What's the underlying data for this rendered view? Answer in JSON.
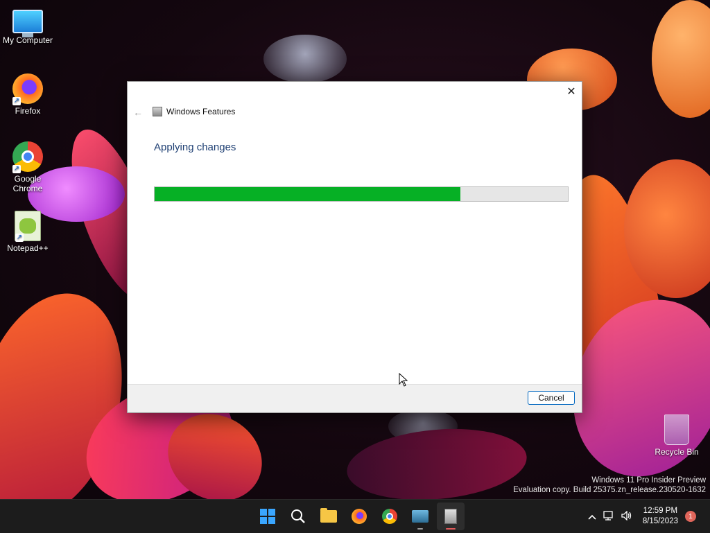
{
  "desktop": {
    "icons": [
      {
        "label": "My Computer",
        "icon": "computer-icon"
      },
      {
        "label": "Firefox",
        "icon": "firefox-icon"
      },
      {
        "label": "Google Chrome",
        "icon": "chrome-icon"
      },
      {
        "label": "Notepad++",
        "icon": "notepadpp-icon"
      },
      {
        "label": "Recycle Bin",
        "icon": "recycle-bin-icon"
      }
    ]
  },
  "dialog": {
    "window_title": "Windows Features",
    "heading": "Applying changes",
    "progress_percent": 74,
    "cancel_label": "Cancel",
    "close_glyph": "✕",
    "back_glyph": "←"
  },
  "watermark": {
    "line1": "Windows 11 Pro Insider Preview",
    "line2": "Evaluation copy. Build 25375.zn_release.230520-1632"
  },
  "taskbar": {
    "apps": [
      {
        "name": "Start",
        "icon": "windows-logo-icon"
      },
      {
        "name": "Search",
        "icon": "search-icon"
      },
      {
        "name": "File Explorer",
        "icon": "folder-icon"
      },
      {
        "name": "Firefox",
        "icon": "firefox-icon"
      },
      {
        "name": "Google Chrome",
        "icon": "chrome-icon"
      },
      {
        "name": "Remote Desktop",
        "icon": "remote-desktop-icon"
      },
      {
        "name": "Windows Features",
        "icon": "windows-features-icon",
        "active": true
      }
    ],
    "tray": {
      "chevron": "^",
      "time": "12:59 PM",
      "date": "8/15/2023",
      "notification_count": "1"
    }
  },
  "colors": {
    "progress_fill": "#06b025",
    "heading": "#1e3f73",
    "taskbar_bg": "#1c1c1c"
  }
}
